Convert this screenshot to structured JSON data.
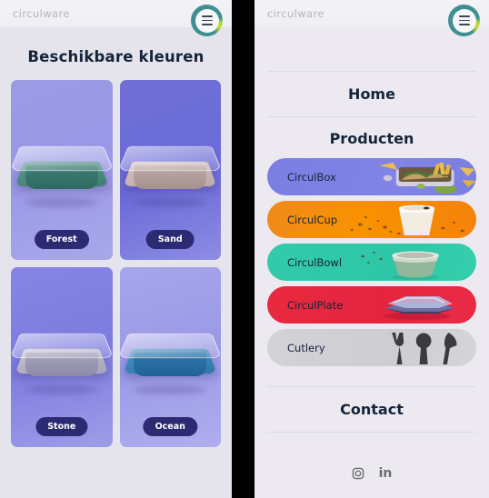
{
  "brand": {
    "logo_text": "circulware",
    "accent_teal": "#3f8f92",
    "accent_green": "#b6d63a"
  },
  "left_panel": {
    "header": {
      "logo": "circulware",
      "menu_icon": "hamburger-icon"
    },
    "title": "Beschikbare kleuren",
    "colors": [
      {
        "name": "Forest",
        "swatch": "#3f7d74"
      },
      {
        "name": "Sand",
        "swatch": "#bdaba9"
      },
      {
        "name": "Stone",
        "swatch": "#a7a4bc"
      },
      {
        "name": "Ocean",
        "swatch": "#2f77ac"
      }
    ]
  },
  "right_panel": {
    "header": {
      "logo": "circulware",
      "menu_icon": "hamburger-icon"
    },
    "nav": [
      {
        "label": "Home",
        "type": "link"
      },
      {
        "label": "Producten",
        "type": "heading"
      },
      {
        "label": "Contact",
        "type": "link"
      }
    ],
    "products": [
      {
        "label": "CirculBox",
        "color": "#7b7ee2"
      },
      {
        "label": "CirculCup",
        "color": "#f99200"
      },
      {
        "label": "CirculBowl",
        "color": "#2ec6a6"
      },
      {
        "label": "CirculPlate",
        "color": "#e32540"
      },
      {
        "label": "Cutlery",
        "color": "#cecdd3"
      }
    ],
    "socials": [
      {
        "name": "instagram-icon",
        "label": ""
      },
      {
        "name": "linkedin-icon",
        "label": "in"
      }
    ]
  }
}
